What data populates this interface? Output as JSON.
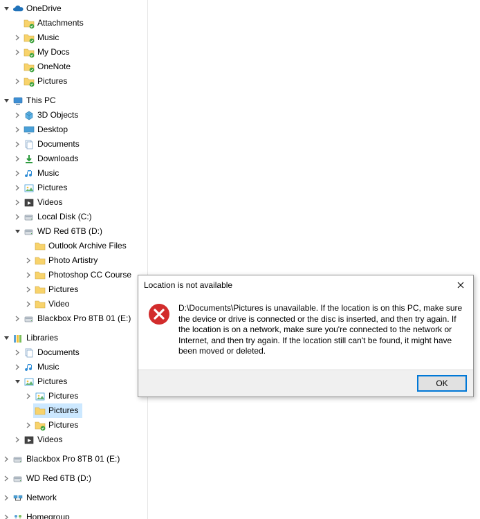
{
  "tree": [
    {
      "label": "OneDrive",
      "indent": 0,
      "chev": "down",
      "icon": "onedrive"
    },
    {
      "label": "Attachments",
      "indent": 1,
      "chev": "none",
      "icon": "folder-sync"
    },
    {
      "label": "Music",
      "indent": 1,
      "chev": "right",
      "icon": "folder-sync"
    },
    {
      "label": "My Docs",
      "indent": 1,
      "chev": "right",
      "icon": "folder-sync"
    },
    {
      "label": "OneNote",
      "indent": 1,
      "chev": "none",
      "icon": "folder-sync"
    },
    {
      "label": "Pictures",
      "indent": 1,
      "chev": "right",
      "icon": "folder-sync"
    },
    {
      "label": "",
      "indent": 0,
      "chev": "none",
      "icon": "blank",
      "blank": true
    },
    {
      "label": "This PC",
      "indent": 0,
      "chev": "down",
      "icon": "pc"
    },
    {
      "label": "3D Objects",
      "indent": 1,
      "chev": "right",
      "icon": "3d"
    },
    {
      "label": "Desktop",
      "indent": 1,
      "chev": "right",
      "icon": "desktop"
    },
    {
      "label": "Documents",
      "indent": 1,
      "chev": "right",
      "icon": "documents"
    },
    {
      "label": "Downloads",
      "indent": 1,
      "chev": "right",
      "icon": "downloads"
    },
    {
      "label": "Music",
      "indent": 1,
      "chev": "right",
      "icon": "music"
    },
    {
      "label": "Pictures",
      "indent": 1,
      "chev": "right",
      "icon": "pictures"
    },
    {
      "label": "Videos",
      "indent": 1,
      "chev": "right",
      "icon": "videos"
    },
    {
      "label": "Local Disk (C:)",
      "indent": 1,
      "chev": "right",
      "icon": "disk"
    },
    {
      "label": "WD Red 6TB (D:)",
      "indent": 1,
      "chev": "down",
      "icon": "disk"
    },
    {
      "label": "Outlook Archive Files",
      "indent": 2,
      "chev": "none",
      "icon": "folder"
    },
    {
      "label": "Photo Artistry",
      "indent": 2,
      "chev": "right",
      "icon": "folder"
    },
    {
      "label": "Photoshop CC Course",
      "indent": 2,
      "chev": "right",
      "icon": "folder"
    },
    {
      "label": "Pictures",
      "indent": 2,
      "chev": "right",
      "icon": "folder"
    },
    {
      "label": "Video",
      "indent": 2,
      "chev": "right",
      "icon": "folder"
    },
    {
      "label": "Blackbox Pro 8TB 01 (E:)",
      "indent": 1,
      "chev": "right",
      "icon": "disk"
    },
    {
      "label": "",
      "indent": 0,
      "chev": "none",
      "icon": "blank",
      "blank": true
    },
    {
      "label": "Libraries",
      "indent": 0,
      "chev": "down",
      "icon": "libraries"
    },
    {
      "label": "Documents",
      "indent": 1,
      "chev": "right",
      "icon": "lib-documents"
    },
    {
      "label": "Music",
      "indent": 1,
      "chev": "right",
      "icon": "lib-music"
    },
    {
      "label": "Pictures",
      "indent": 1,
      "chev": "down",
      "icon": "lib-pictures"
    },
    {
      "label": "Pictures",
      "indent": 2,
      "chev": "right",
      "icon": "pictures"
    },
    {
      "label": "Pictures",
      "indent": 2,
      "chev": "none",
      "icon": "folder",
      "selected": true
    },
    {
      "label": "Pictures",
      "indent": 2,
      "chev": "right",
      "icon": "folder-sync"
    },
    {
      "label": "Videos",
      "indent": 1,
      "chev": "right",
      "icon": "lib-videos"
    },
    {
      "label": "",
      "indent": 0,
      "chev": "none",
      "icon": "blank",
      "blank": true
    },
    {
      "label": "Blackbox Pro 8TB 01 (E:)",
      "indent": 0,
      "chev": "right",
      "icon": "disk"
    },
    {
      "label": "",
      "indent": 0,
      "chev": "none",
      "icon": "blank",
      "blank": true
    },
    {
      "label": "WD Red 6TB (D:)",
      "indent": 0,
      "chev": "right",
      "icon": "disk"
    },
    {
      "label": "",
      "indent": 0,
      "chev": "none",
      "icon": "blank",
      "blank": true
    },
    {
      "label": "Network",
      "indent": 0,
      "chev": "right",
      "icon": "network"
    },
    {
      "label": "",
      "indent": 0,
      "chev": "none",
      "icon": "blank",
      "blank": true
    },
    {
      "label": "Homegroup",
      "indent": 0,
      "chev": "right",
      "icon": "homegroup"
    }
  ],
  "dialog": {
    "title": "Location is not available",
    "message": "D:\\Documents\\Pictures is unavailable. If the location is on this PC, make sure the device or drive is connected or the disc is inserted, and then try again. If the location is on a network, make sure you're connected to the network or Internet, and then try again. If the location still can't be found, it might have been moved or deleted.",
    "ok_label": "OK"
  }
}
